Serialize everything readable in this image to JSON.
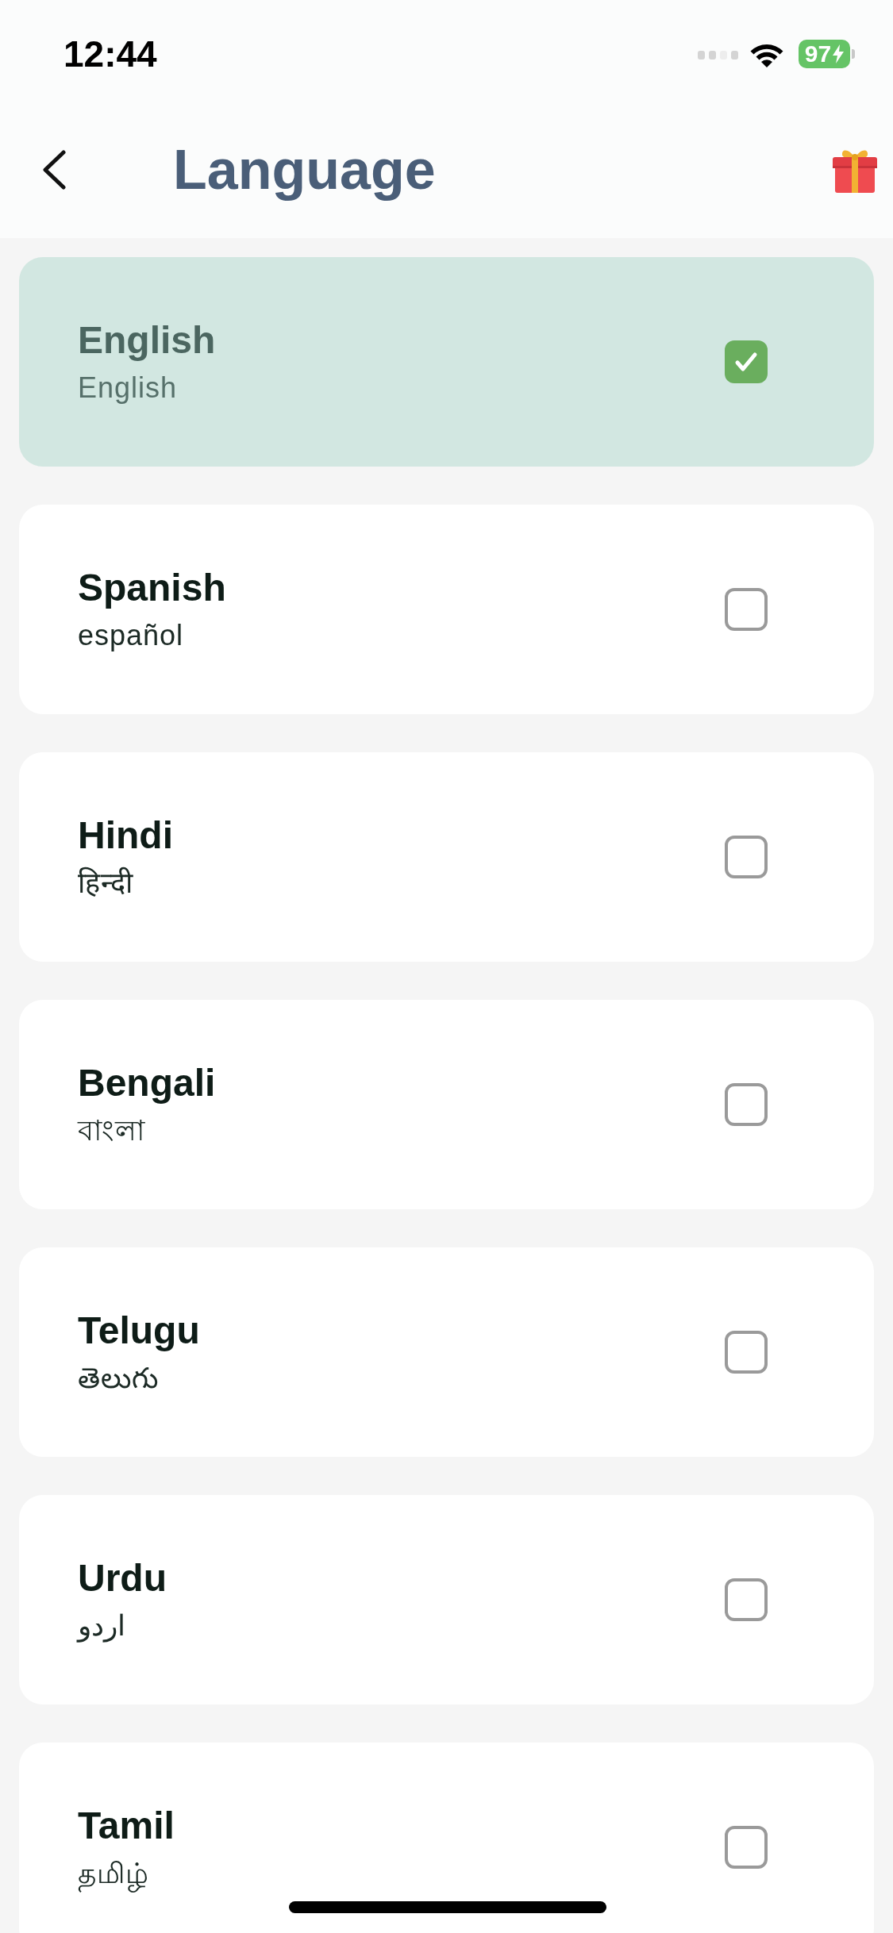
{
  "status_bar": {
    "time": "12:44",
    "battery": "97"
  },
  "header": {
    "title": "Language"
  },
  "languages": [
    {
      "name": "English",
      "native": "English",
      "selected": true
    },
    {
      "name": "Spanish",
      "native": "español",
      "selected": false
    },
    {
      "name": "Hindi",
      "native": "हिन्दी",
      "selected": false
    },
    {
      "name": "Bengali",
      "native": "বাংলা",
      "selected": false
    },
    {
      "name": "Telugu",
      "native": "తెలుగు",
      "selected": false
    },
    {
      "name": "Urdu",
      "native": "اردو",
      "selected": false
    },
    {
      "name": "Tamil",
      "native": "தமிழ்",
      "selected": false
    }
  ]
}
